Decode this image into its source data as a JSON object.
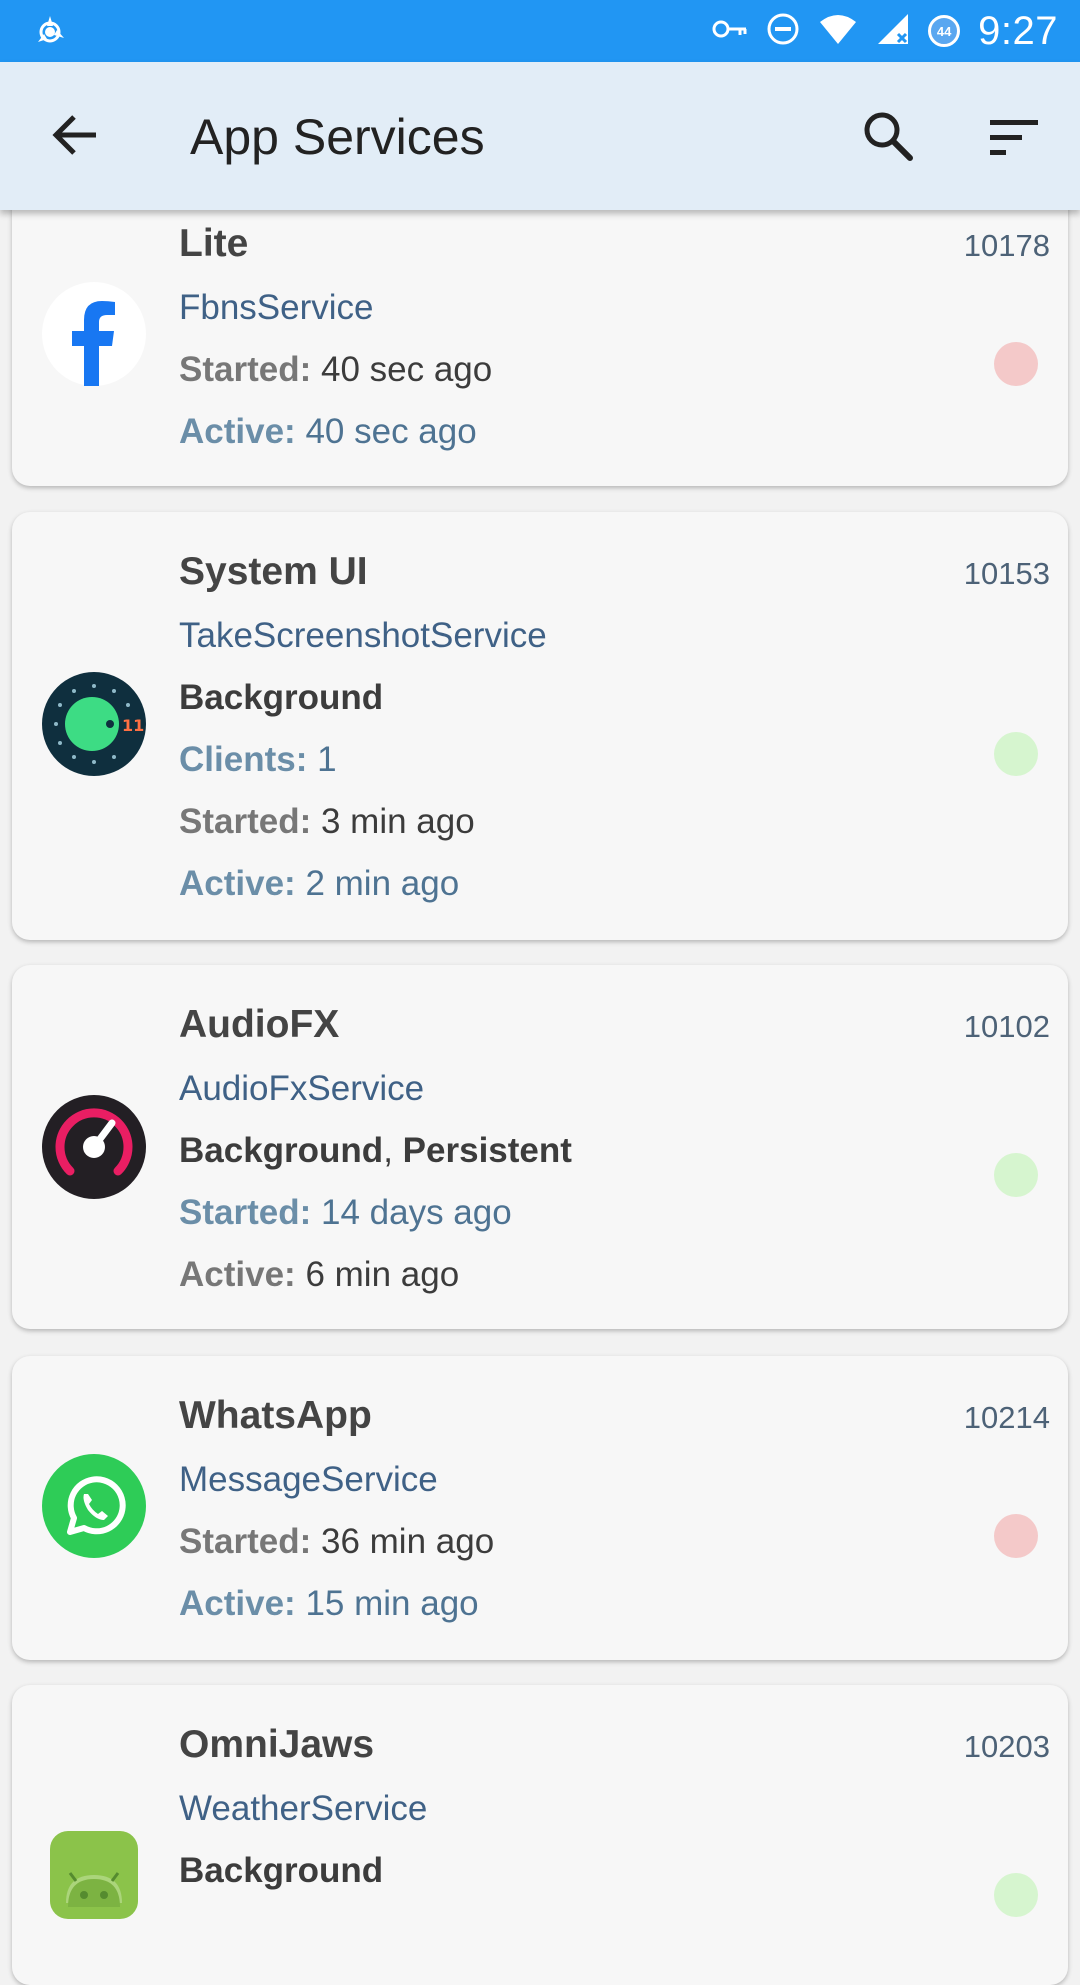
{
  "status_bar": {
    "time": "9:27",
    "battery": "44"
  },
  "app_bar": {
    "title": "App Services"
  },
  "services": [
    {
      "app": "Lite",
      "uid": "10178",
      "service": "FbnsService",
      "started_label": "Started:",
      "started": "40 sec ago",
      "active_label": "Active:",
      "active": "40 sec ago",
      "status_color": "#f4c9c9"
    },
    {
      "app": "System UI",
      "uid": "10153",
      "service": "TakeScreenshotService",
      "state": "Background",
      "clients_label": "Clients:",
      "clients": "1",
      "started_label": "Started:",
      "started": "3 min ago",
      "active_label": "Active:",
      "active": "2 min ago",
      "status_color": "#d6f5cf"
    },
    {
      "app": "AudioFX",
      "uid": "10102",
      "service": "AudioFxService",
      "state_1": "Background",
      "state_sep": ",",
      "state_2": "Persistent",
      "started_label": "Started:",
      "started": "14 days ago",
      "active_label": "Active:",
      "active": "6 min ago",
      "status_color": "#d6f5cf"
    },
    {
      "app": "WhatsApp",
      "uid": "10214",
      "service": "MessageService",
      "started_label": "Started:",
      "started": "36 min ago",
      "active_label": "Active:",
      "active": "15 min ago",
      "status_color": "#f4c9c9"
    },
    {
      "app": "OmniJaws",
      "uid": "10203",
      "service": "WeatherService",
      "state": "Background",
      "status_color": "#d6f5cf"
    }
  ],
  "colors": {
    "status_bar": "#2196f3",
    "app_bar": "#e2edf7",
    "card": "#f7f7f7"
  }
}
